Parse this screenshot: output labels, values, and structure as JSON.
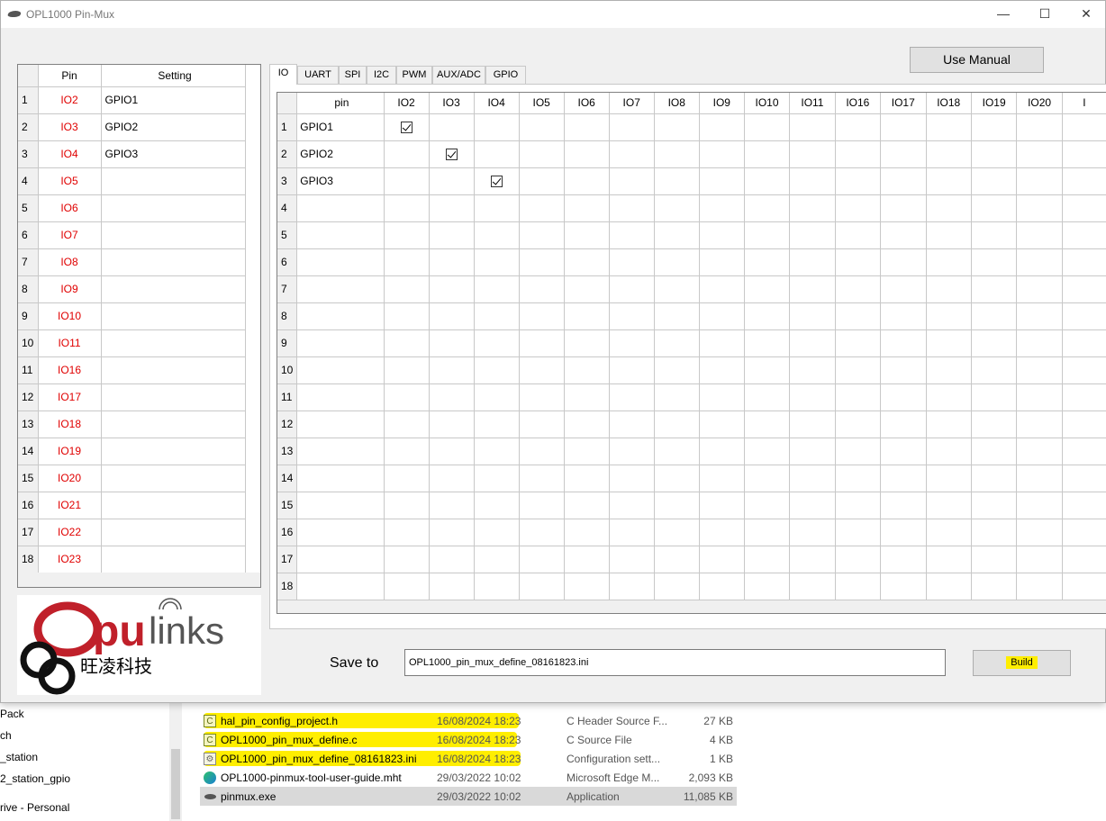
{
  "window": {
    "title": "OPL1000 Pin-Mux",
    "minimize": "—",
    "maximize": "☐",
    "close": "✕"
  },
  "pin_table": {
    "headers": {
      "pin": "Pin",
      "setting": "Setting"
    },
    "rows": [
      {
        "n": "1",
        "pin": "IO2",
        "setting": "GPIO1"
      },
      {
        "n": "2",
        "pin": "IO3",
        "setting": "GPIO2"
      },
      {
        "n": "3",
        "pin": "IO4",
        "setting": "GPIO3"
      },
      {
        "n": "4",
        "pin": "IO5",
        "setting": ""
      },
      {
        "n": "5",
        "pin": "IO6",
        "setting": ""
      },
      {
        "n": "6",
        "pin": "IO7",
        "setting": ""
      },
      {
        "n": "7",
        "pin": "IO8",
        "setting": ""
      },
      {
        "n": "8",
        "pin": "IO9",
        "setting": ""
      },
      {
        "n": "9",
        "pin": "IO10",
        "setting": ""
      },
      {
        "n": "10",
        "pin": "IO11",
        "setting": ""
      },
      {
        "n": "11",
        "pin": "IO16",
        "setting": ""
      },
      {
        "n": "12",
        "pin": "IO17",
        "setting": ""
      },
      {
        "n": "13",
        "pin": "IO18",
        "setting": ""
      },
      {
        "n": "14",
        "pin": "IO19",
        "setting": ""
      },
      {
        "n": "15",
        "pin": "IO20",
        "setting": ""
      },
      {
        "n": "16",
        "pin": "IO21",
        "setting": ""
      },
      {
        "n": "17",
        "pin": "IO22",
        "setting": ""
      },
      {
        "n": "18",
        "pin": "IO23",
        "setting": ""
      }
    ]
  },
  "logo": {
    "text_o": "O",
    "text_pu": "pu",
    "text_links": "links",
    "chinese": "旺凌科技"
  },
  "tabs": [
    "IO",
    "UART",
    "SPI",
    "I2C",
    "PWM",
    "AUX/ADC",
    "GPIO"
  ],
  "io_grid": {
    "pin_header": "pin",
    "columns": [
      "IO2",
      "IO3",
      "IO4",
      "IO5",
      "IO6",
      "IO7",
      "IO8",
      "IO9",
      "IO10",
      "IO11",
      "IO16",
      "IO17",
      "IO18",
      "IO19",
      "IO20",
      "I"
    ],
    "rows": [
      {
        "n": "1",
        "pin": "GPIO1",
        "checked": [
          0
        ]
      },
      {
        "n": "2",
        "pin": "GPIO2",
        "checked": [
          1
        ]
      },
      {
        "n": "3",
        "pin": "GPIO3",
        "checked": [
          2
        ]
      },
      {
        "n": "4",
        "pin": "",
        "checked": []
      },
      {
        "n": "5",
        "pin": "",
        "checked": []
      },
      {
        "n": "6",
        "pin": "",
        "checked": []
      },
      {
        "n": "7",
        "pin": "",
        "checked": []
      },
      {
        "n": "8",
        "pin": "",
        "checked": []
      },
      {
        "n": "9",
        "pin": "",
        "checked": []
      },
      {
        "n": "10",
        "pin": "",
        "checked": []
      },
      {
        "n": "11",
        "pin": "",
        "checked": []
      },
      {
        "n": "12",
        "pin": "",
        "checked": []
      },
      {
        "n": "13",
        "pin": "",
        "checked": []
      },
      {
        "n": "14",
        "pin": "",
        "checked": []
      },
      {
        "n": "15",
        "pin": "",
        "checked": []
      },
      {
        "n": "16",
        "pin": "",
        "checked": []
      },
      {
        "n": "17",
        "pin": "",
        "checked": []
      },
      {
        "n": "18",
        "pin": "",
        "checked": []
      }
    ]
  },
  "controls": {
    "use_manual": "Use Manual",
    "save_label": "Save to",
    "save_value": "OPL1000_pin_mux_define_08161823.ini",
    "build": "Build"
  },
  "explorer": {
    "nav": [
      "Pack",
      "ch",
      "_station",
      "2_station_gpio",
      "rive - Personal"
    ],
    "files": [
      {
        "icon": "c-file-icon",
        "name": "hal_pin_config_project.h",
        "date": "16/08/2024 18:23",
        "type": "C Header Source F...",
        "size": "27 KB",
        "highlight": true
      },
      {
        "icon": "c-file-icon",
        "name": "OPL1000_pin_mux_define.c",
        "date": "16/08/2024 18:23",
        "type": "C Source File",
        "size": "4 KB",
        "highlight": true
      },
      {
        "icon": "ini-file-icon",
        "name": "OPL1000_pin_mux_define_08161823.ini",
        "date": "16/08/2024 18:23",
        "type": "Configuration sett...",
        "size": "1 KB",
        "highlight": true
      },
      {
        "icon": "edge-icon",
        "name": "OPL1000-pinmux-tool-user-guide.mht",
        "date": "29/03/2022 10:02",
        "type": "Microsoft Edge M...",
        "size": "2,093 KB",
        "highlight": false
      },
      {
        "icon": "app-icon",
        "name": "pinmux.exe",
        "date": "29/03/2022 10:02",
        "type": "Application",
        "size": "11,085 KB",
        "highlight": false,
        "selected": true
      }
    ]
  },
  "colors": {
    "pin_text": "#e00000",
    "highlight": "#ffee00",
    "logo_red": "#c0202a",
    "window_bg": "#f0f0f0"
  }
}
